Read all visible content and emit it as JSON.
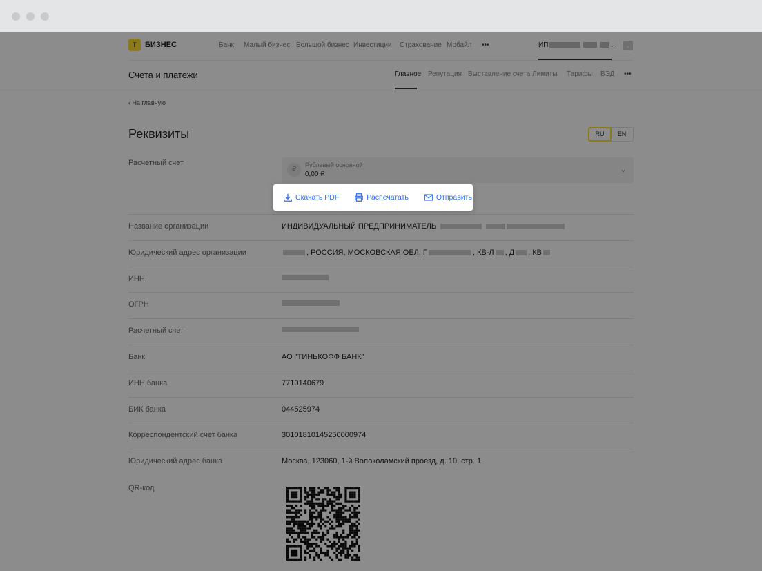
{
  "header": {
    "logo": "БИЗНЕС",
    "nav": [
      "Банк",
      "Малый бизнес",
      "Большой бизнес",
      "Инвестиции",
      "Страхование",
      "Мобайл"
    ],
    "more": "•••",
    "account": "ИП"
  },
  "subheader": {
    "title": "Счета и платежи",
    "tabs": [
      "Главное",
      "Репутация",
      "Выставление счета",
      "Лимиты",
      "Тарифы",
      "ВЭД"
    ],
    "more": "•••",
    "active_tab": "Главное"
  },
  "breadcrumb": "На главную",
  "page_title": "Реквизиты",
  "lang": {
    "ru": "RU",
    "en": "EN",
    "active": "RU"
  },
  "account_select": {
    "label": "Расчетный счет",
    "name": "Рублевый основной",
    "balance": "0,00 ₽",
    "currency_icon": "₽"
  },
  "popup": {
    "download": "Скачать PDF",
    "print": "Распечатать",
    "send": "Отправить"
  },
  "rows": [
    {
      "label": "Название организации",
      "value": "ИНДИВИДУАЛЬНЫЙ ПРЕДПРИНИМАТЕЛЬ"
    },
    {
      "label": "Юридический адрес организации",
      "value": ", РОССИЯ, МОСКОВСКАЯ ОБЛ, Г"
    },
    {
      "label": "ИНН",
      "value": ""
    },
    {
      "label": "ОГРН",
      "value": ""
    },
    {
      "label": "Расчетный счет",
      "value": ""
    },
    {
      "label": "Банк",
      "value": "АО \"ТИНЬКОФФ БАНК\""
    },
    {
      "label": "ИНН банка",
      "value": "7710140679"
    },
    {
      "label": "БИК банка",
      "value": "044525974"
    },
    {
      "label": "Корреспондентский счет банка",
      "value": "30101810145250000974"
    },
    {
      "label": "Юридический адрес банка",
      "value": "Москва, 123060, 1-й Волоколамский проезд, д. 10, стр. 1"
    }
  ],
  "address_parts": {
    "kvl": ", КВ-Л",
    "d": ", Д",
    "kv": ", КВ"
  },
  "qr_label": "QR-код",
  "colors": {
    "accent": "#336fee",
    "brand": "#ffdd2d"
  }
}
